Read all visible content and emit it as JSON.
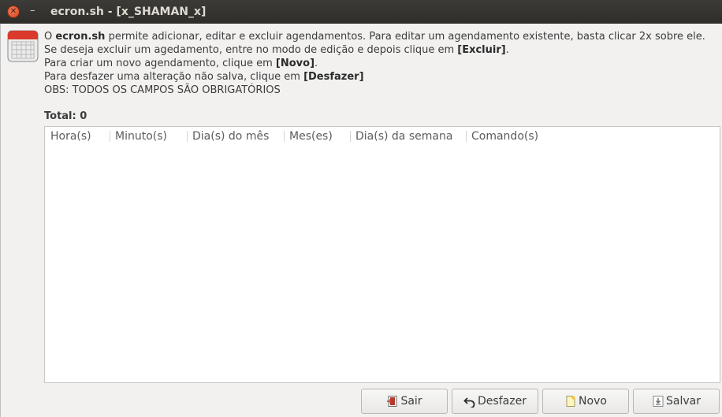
{
  "window": {
    "title": "ecron.sh - [x_SHAMAN_x]",
    "close_glyph": "✕",
    "minimize_glyph": "–"
  },
  "info": {
    "line1_pre": "O ",
    "line1_app": "ecron.sh",
    "line1_post": " permite adicionar, editar e excluir agendamentos. Para editar um agendamento existente, basta clicar 2x sobre ele.",
    "line2_pre": "Se deseja excluir um agedamento, entre no modo de edição e depois clique em ",
    "line2_btn": "[Excluir]",
    "line2_post": ".",
    "line3_pre": "Para criar um novo agendamento, clique em ",
    "line3_btn": "[Novo]",
    "line3_post": ".",
    "line4_pre": "Para desfazer uma alteração não salva, clique em ",
    "line4_btn": "[Desfazer]",
    "line5": "OBS: TODOS OS CAMPOS SÃO OBRIGATÓRIOS"
  },
  "total_label": "Total: 0",
  "table": {
    "columns": [
      "Hora(s)",
      "Minuto(s)",
      "Dia(s) do mês",
      "Mes(es)",
      "Dia(s) da semana",
      "Comando(s)"
    ],
    "rows": []
  },
  "buttons": {
    "sair": "Sair",
    "desfazer": "Desfazer",
    "novo": "Novo",
    "salvar": "Salvar"
  },
  "icons": {
    "app": "calendar-icon",
    "sair": "exit-door-icon",
    "desfazer": "undo-arrow-icon",
    "novo": "new-document-icon",
    "salvar": "save-download-icon"
  },
  "colors": {
    "titlebar": "#3c3b37",
    "close_button": "#e8572f",
    "calendar_red": "#d93a2b"
  }
}
